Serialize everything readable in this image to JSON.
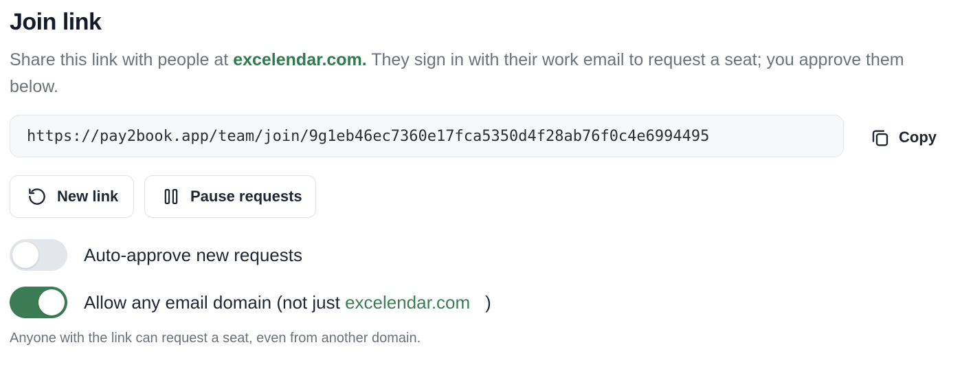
{
  "section": {
    "title": "Join link",
    "description_pre": "Share this link with people at ",
    "description_domain": "excelendar.com.",
    "description_post": " They sign in with their work email to request a seat; you approve them below."
  },
  "link": {
    "url": "https://pay2book.app/team/join/9g1eb46ec7360e17fca5350d4f28ab76f0c4e6994495",
    "copy_label": "Copy"
  },
  "actions": {
    "new_link_label": "New link",
    "pause_label": "Pause requests"
  },
  "toggles": {
    "auto_approve": {
      "label": "Auto-approve new requests",
      "enabled": false
    },
    "any_domain": {
      "label_pre": "Allow any email domain (not just ",
      "label_domain": "excelendar.com",
      "label_post": ")",
      "enabled": true
    }
  },
  "hint": "Anyone with the link can request a seat, even from another domain.",
  "colors": {
    "accent": "#3b7c55",
    "toggle_off": "#e3e6ea",
    "muted_text": "#6c717c"
  },
  "icons": {
    "copy": "copy-icon",
    "refresh": "refresh-icon",
    "pause": "pause-icon"
  }
}
